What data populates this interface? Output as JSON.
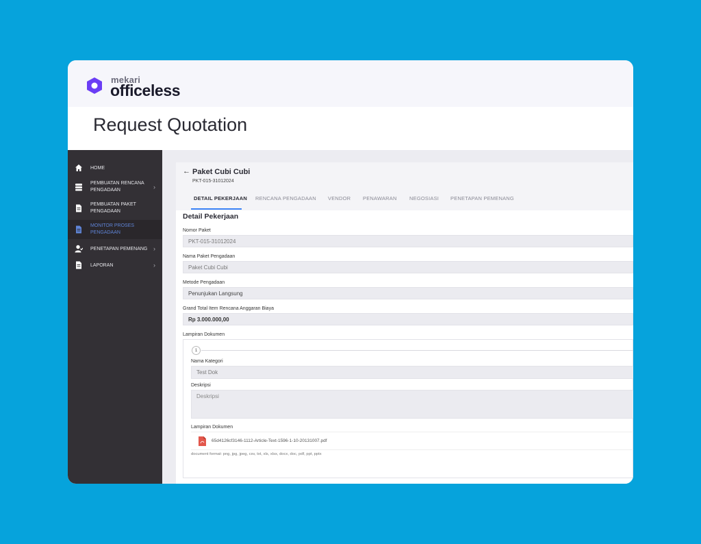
{
  "brand": {
    "small": "mekari",
    "big": "officeless"
  },
  "page_heading": "Request Quotation",
  "sidebar": {
    "items": [
      {
        "label": "HOME",
        "icon": "home-icon",
        "has_chevron": false,
        "active": false
      },
      {
        "label": "PEMBUATAN RENCANA PENGADAAN",
        "icon": "database-icon",
        "has_chevron": true,
        "active": false
      },
      {
        "label": "PEMBUATAN PAKET PENGADAAN",
        "icon": "document-icon",
        "has_chevron": false,
        "active": false
      },
      {
        "label": "MONITOR PROSES PENGADAAN",
        "icon": "document-icon",
        "has_chevron": false,
        "active": true
      },
      {
        "label": "PENETAPAN PEMENANG",
        "icon": "user-icon",
        "has_chevron": true,
        "active": false
      },
      {
        "label": "LAPORAN",
        "icon": "document-icon",
        "has_chevron": true,
        "active": false
      }
    ],
    "chevron": "›"
  },
  "package": {
    "back_arrow": "←",
    "title": "Paket Cubi Cubi",
    "code": "PKT-015-31012024"
  },
  "tabs": [
    {
      "label": "DETAIL PEKERJAAN",
      "active": true
    },
    {
      "label": "RENCANA PENGADAAN",
      "active": false
    },
    {
      "label": "VENDOR",
      "active": false
    },
    {
      "label": "PENAWARAN",
      "active": false
    },
    {
      "label": "NEGOSIASI",
      "active": false
    },
    {
      "label": "PENETAPAN PEMENANG",
      "active": false
    }
  ],
  "section_title": "Detail Pekerjaan",
  "fields": {
    "nomor_paket": {
      "label": "Nomor Paket",
      "value": "PKT-015-31012024"
    },
    "nama_paket": {
      "label": "Nama Paket Pengadaan",
      "value": "Paket Cubi Cubi"
    },
    "metode": {
      "label": "Metode Pengadaan",
      "value": "Penunjukan Langsung"
    },
    "grand_total": {
      "label": "Grand Total Item Rencana Anggaran Biaya",
      "value": "Rp 3.000.000,00"
    },
    "lampiran_label": "Lampiran Dokumen"
  },
  "attachment": {
    "number": "1",
    "kategori_label": "Nama Kategori",
    "kategori_value": "Test Dok",
    "deskripsi_label": "Deskripsi",
    "deskripsi_placeholder": "Deskripsi",
    "lampiran_label": "Lampiran Dokumen",
    "file_name": "65d4126cf3146-1112-Article-Text-1596-1-10-20131007.pdf",
    "format_note": "document format: png, jpg, jpeg, csv, txt, xls, xlsx, docx, doc, pdf, ppt, pptx"
  },
  "colors": {
    "background": "#06a3dc",
    "sidebar": "#333035",
    "accent": "#3b82f6",
    "brand_purple": "#6b3df5",
    "pdf_red": "#e2574c"
  }
}
